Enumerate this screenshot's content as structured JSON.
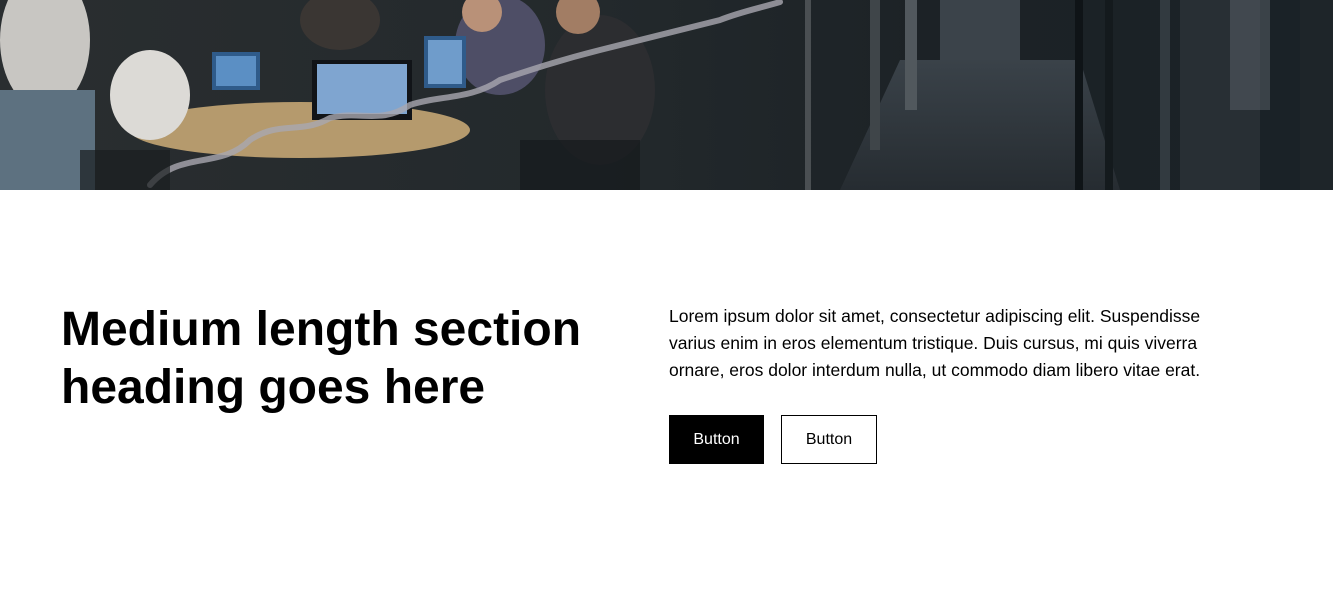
{
  "section": {
    "heading": "Medium length section heading goes here",
    "body": "Lorem ipsum dolor sit amet, consectetur adipiscing elit. Suspendisse varius enim in eros elementum tristique. Duis cursus, mi quis viverra ornare, eros dolor interdum nulla, ut commodo diam libero vitae erat.",
    "primary_button": "Button",
    "secondary_button": "Button"
  },
  "colors": {
    "primary_button_bg": "#000000",
    "primary_button_text": "#ffffff",
    "secondary_button_border": "#000000",
    "background": "#ffffff"
  }
}
